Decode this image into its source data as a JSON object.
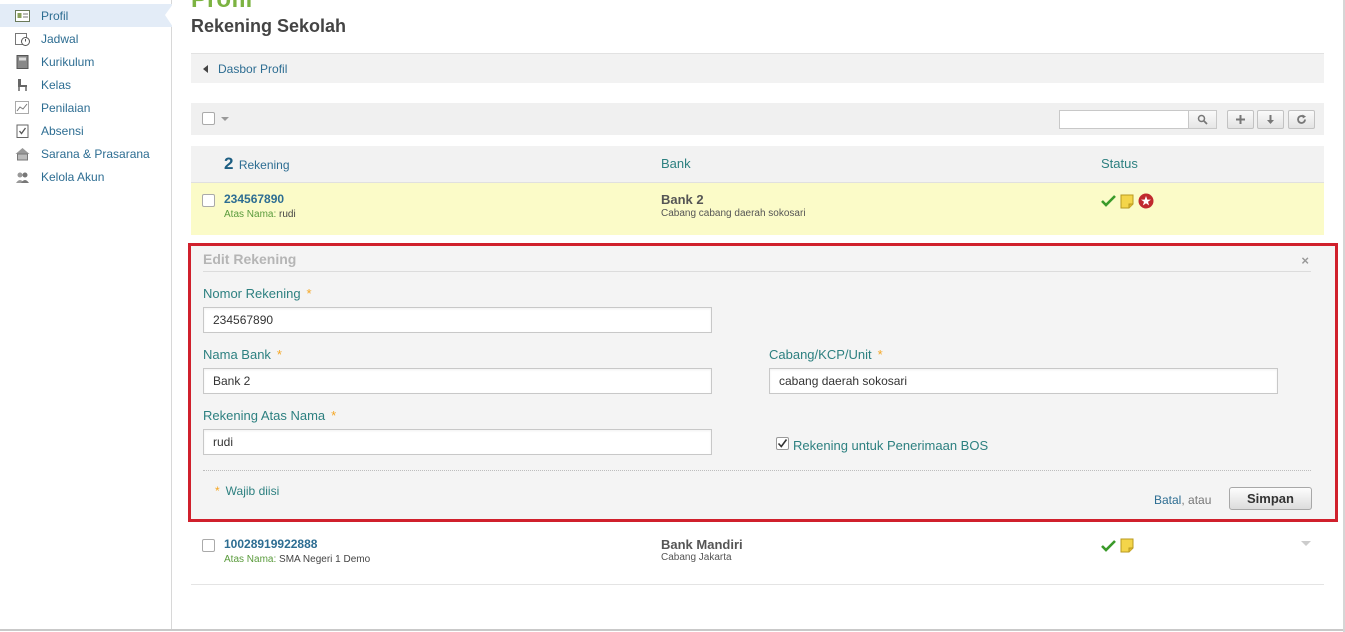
{
  "sidebar": {
    "items": [
      {
        "label": "Profil",
        "icon": "profile-card-icon",
        "active": true
      },
      {
        "label": "Jadwal",
        "icon": "calendar-clock-icon"
      },
      {
        "label": "Kurikulum",
        "icon": "book-icon"
      },
      {
        "label": "Kelas",
        "icon": "chair-icon"
      },
      {
        "label": "Penilaian",
        "icon": "chart-icon"
      },
      {
        "label": "Absensi",
        "icon": "clipboard-check-icon"
      },
      {
        "label": "Sarana & Prasarana",
        "icon": "building-icon"
      },
      {
        "label": "Kelola Akun",
        "icon": "users-icon"
      }
    ]
  },
  "header": {
    "top_text": "Profil",
    "title": "Rekening Sekolah",
    "back_link": "Dasbor Profil"
  },
  "table": {
    "count": "2",
    "count_label": "Rekening",
    "col_bank": "Bank",
    "col_status": "Status",
    "rows": [
      {
        "account": "234567890",
        "owner_label": "Atas Nama:",
        "owner": "rudi",
        "bank": "Bank 2",
        "branch": "Cabang cabang daerah sokosari"
      },
      {
        "account": "10028919922888",
        "owner_label": "Atas Nama:",
        "owner": "SMA Negeri 1 Demo",
        "bank": "Bank Mandiri",
        "branch": "Cabang Jakarta"
      }
    ]
  },
  "edit_form": {
    "title": "Edit Rekening",
    "close": "×",
    "nomor_label": "Nomor Rekening",
    "nomor_value": "234567890",
    "bank_label": "Nama Bank",
    "bank_value": "Bank 2",
    "cabang_label": "Cabang/KCP/Unit",
    "cabang_value": "cabang daerah sokosari",
    "atas_nama_label": "Rekening Atas Nama",
    "atas_nama_value": "rudi",
    "bos_label": "Rekening untuk Penerimaan BOS",
    "bos_checked": true,
    "required_star": "*",
    "required_note": "Wajib diisi",
    "cancel": "Batal",
    "or": ", atau",
    "save": "Simpan"
  },
  "colors": {
    "link": "#2d6d92",
    "label": "#2d8080",
    "highlight_row": "#fbfbc8",
    "edit_border": "#d0202c",
    "required": "#f5a623"
  }
}
